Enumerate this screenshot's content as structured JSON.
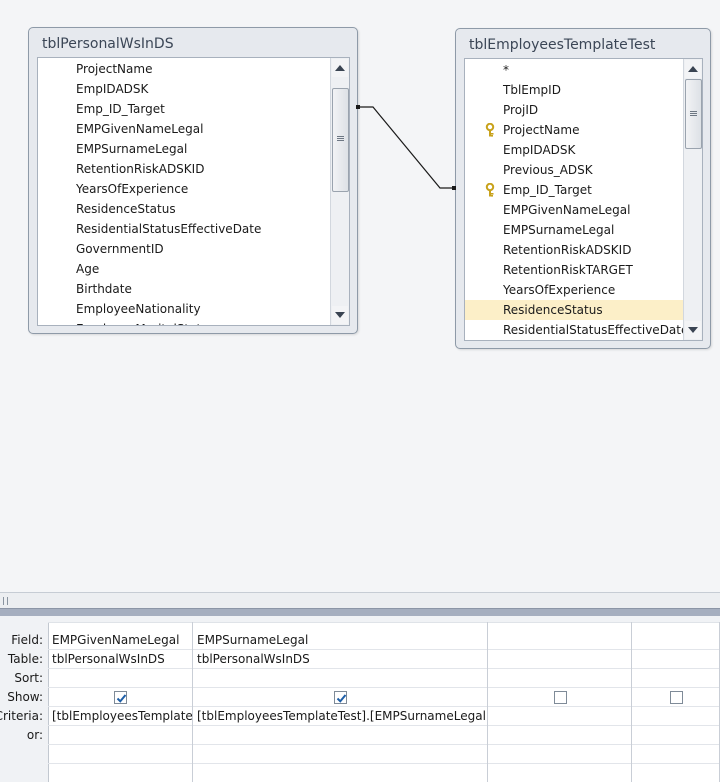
{
  "tables": [
    {
      "title": "tblPersonalWsInDS",
      "fields": [
        {
          "name": "ProjectName"
        },
        {
          "name": "EmpIDADSK"
        },
        {
          "name": "Emp_ID_Target"
        },
        {
          "name": "EMPGivenNameLegal"
        },
        {
          "name": "EMPSurnameLegal"
        },
        {
          "name": "RetentionRiskADSKID"
        },
        {
          "name": "YearsOfExperience"
        },
        {
          "name": "ResidenceStatus"
        },
        {
          "name": "ResidentialStatusEffectiveDate"
        },
        {
          "name": "GovernmentID"
        },
        {
          "name": "Age"
        },
        {
          "name": "Birthdate"
        },
        {
          "name": "EmployeeNationality"
        },
        {
          "name": "EmployeeMaritalStat"
        }
      ]
    },
    {
      "title": "tblEmployeesTemplateTest",
      "fields": [
        {
          "name": "*"
        },
        {
          "name": "TblEmpID"
        },
        {
          "name": "ProjID"
        },
        {
          "name": "ProjectName",
          "key": true
        },
        {
          "name": "EmpIDADSK"
        },
        {
          "name": "Previous_ADSK"
        },
        {
          "name": "Emp_ID_Target",
          "key": true
        },
        {
          "name": "EMPGivenNameLegal"
        },
        {
          "name": "EMPSurnameLegal"
        },
        {
          "name": "RetentionRiskADSKID"
        },
        {
          "name": "RetentionRiskTARGET"
        },
        {
          "name": "YearsOfExperience"
        },
        {
          "name": "ResidenceStatus",
          "selected": true
        },
        {
          "name": "ResidentialStatusEffectiveDate"
        }
      ]
    }
  ],
  "grid": {
    "row_labels": {
      "field": "Field:",
      "table": "Table:",
      "sort": "Sort:",
      "show": "Show:",
      "criteria": "Criteria:",
      "or": "or:"
    },
    "columns": [
      {
        "field": "EMPGivenNameLegal",
        "table": "tblPersonalWsInDS",
        "sort": "",
        "show": true,
        "criteria": "[tblEmployeesTemplateTest].[EMPGivenNameLegal]",
        "or": ""
      },
      {
        "field": "EMPSurnameLegal",
        "table": "tblPersonalWsInDS",
        "sort": "",
        "show": true,
        "criteria": "[tblEmployeesTemplateTest].[EMPSurnameLegal]",
        "or": ""
      },
      {
        "field": "",
        "table": "",
        "sort": "",
        "show": false,
        "criteria": "",
        "or": ""
      },
      {
        "field": "",
        "table": "",
        "sort": "",
        "show": false,
        "criteria": "",
        "or": ""
      }
    ]
  },
  "icons": {
    "key": "key-icon",
    "scroll_up": "scroll-up-arrow-icon",
    "scroll_down": "scroll-down-arrow-icon",
    "checkbox_checked": "checkmark-icon"
  },
  "colors": {
    "selected_row": "#fcefc8",
    "checkmark": "#1e5fa8",
    "key_icon": "#c8a21c"
  }
}
